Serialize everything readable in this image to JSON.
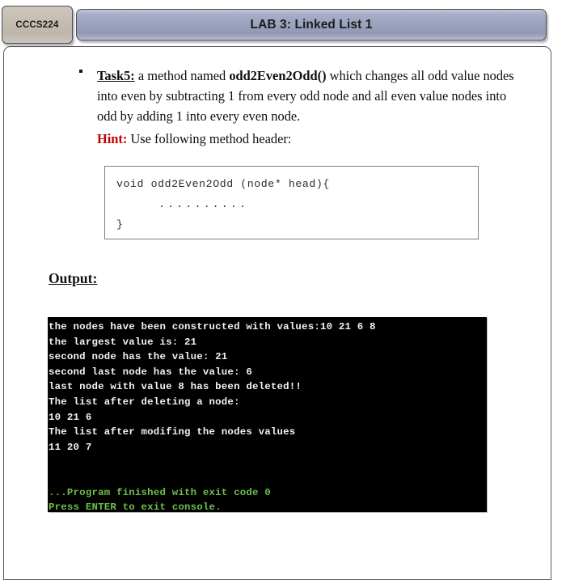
{
  "header": {
    "course_tab": "CCCS224",
    "title": "LAB 3: Linked List 1"
  },
  "task": {
    "label": "Task5:",
    "text_part1": " a method named ",
    "method_name": "odd2Even2Odd()",
    "text_part2": " which changes all odd value nodes into even by subtracting 1 from every odd node and all even value nodes into odd by adding 1 into every even node."
  },
  "hint": {
    "label": "Hint:",
    "text": " Use following method header:"
  },
  "code": {
    "line1": "void odd2Even2Odd (node* head){",
    "line2": "..........",
    "line3": "}"
  },
  "output": {
    "heading": "Output:"
  },
  "terminal": {
    "lines": [
      {
        "text": "the nodes have been constructed with values:10 21 6 8",
        "color": "white"
      },
      {
        "text": "the largest value is: 21",
        "color": "white"
      },
      {
        "text": "second node has the value: 21",
        "color": "white"
      },
      {
        "text": "second last node has the value: 6",
        "color": "white"
      },
      {
        "text": "last node with value 8 has been deleted!!",
        "color": "white"
      },
      {
        "text": "The list after deleting a node:",
        "color": "white"
      },
      {
        "text": "10 21 6",
        "color": "white"
      },
      {
        "text": "The list after modifing the nodes values",
        "color": "white"
      },
      {
        "text": "11 20 7",
        "color": "white"
      },
      {
        "text": "",
        "color": "blank"
      },
      {
        "text": "",
        "color": "blank"
      },
      {
        "text": "...Program finished with exit code 0",
        "color": "green"
      },
      {
        "text": "Press ENTER to exit console.",
        "color": "green"
      }
    ]
  },
  "colors": {
    "banner": "#9aa1bb",
    "tab": "#c6bdb2",
    "hint_red": "#c00000",
    "terminal_bg": "#000000",
    "terminal_text": "#f2f2f2",
    "terminal_green": "#6ec04a"
  }
}
